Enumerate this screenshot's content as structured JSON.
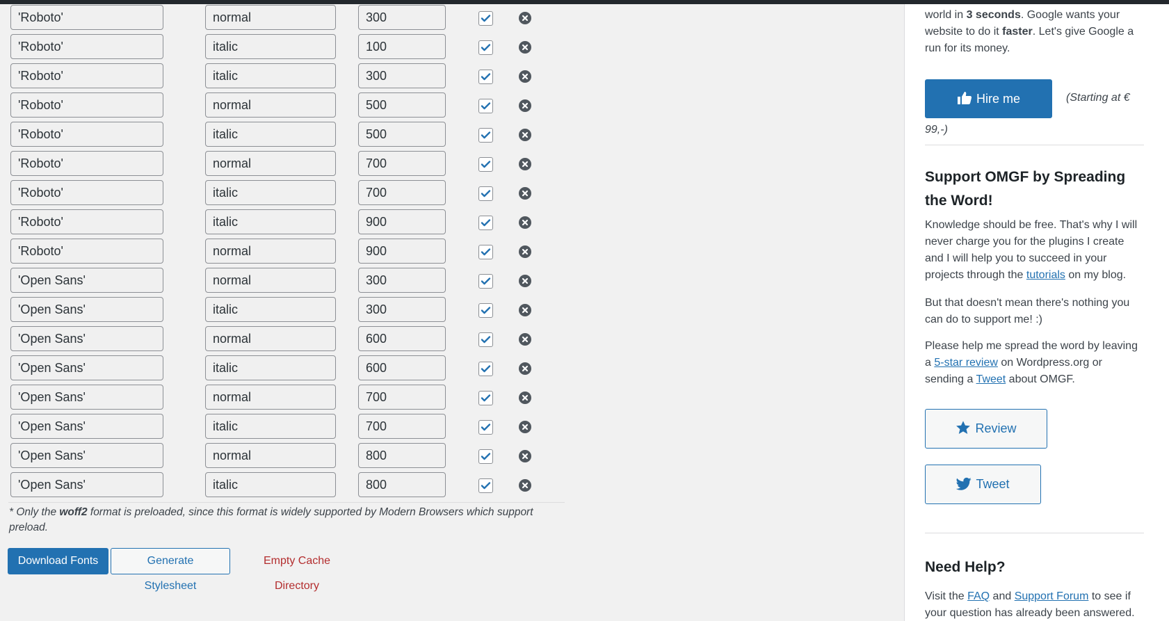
{
  "fonts": [
    {
      "family": "'Roboto'",
      "style": "normal",
      "weight": "300"
    },
    {
      "family": "'Roboto'",
      "style": "italic",
      "weight": "100"
    },
    {
      "family": "'Roboto'",
      "style": "italic",
      "weight": "300"
    },
    {
      "family": "'Roboto'",
      "style": "normal",
      "weight": "500"
    },
    {
      "family": "'Roboto'",
      "style": "italic",
      "weight": "500"
    },
    {
      "family": "'Roboto'",
      "style": "normal",
      "weight": "700"
    },
    {
      "family": "'Roboto'",
      "style": "italic",
      "weight": "700"
    },
    {
      "family": "'Roboto'",
      "style": "italic",
      "weight": "900"
    },
    {
      "family": "'Roboto'",
      "style": "normal",
      "weight": "900"
    },
    {
      "family": "'Open Sans'",
      "style": "normal",
      "weight": "300"
    },
    {
      "family": "'Open Sans'",
      "style": "italic",
      "weight": "300"
    },
    {
      "family": "'Open Sans'",
      "style": "normal",
      "weight": "600"
    },
    {
      "family": "'Open Sans'",
      "style": "italic",
      "weight": "600"
    },
    {
      "family": "'Open Sans'",
      "style": "normal",
      "weight": "700"
    },
    {
      "family": "'Open Sans'",
      "style": "italic",
      "weight": "700"
    },
    {
      "family": "'Open Sans'",
      "style": "normal",
      "weight": "800"
    },
    {
      "family": "'Open Sans'",
      "style": "italic",
      "weight": "800"
    }
  ],
  "note": {
    "prefix": "* Only the ",
    "bold": "woff2",
    "suffix": " format is preloaded, since this format is widely supported by Modern Browsers which support preload."
  },
  "actions": {
    "download": "Download Fonts",
    "generate": "Generate Stylesheet",
    "empty_cache": "Empty Cache Directory"
  },
  "sidebar": {
    "intro": {
      "p1": "world in ",
      "b1": "3 seconds",
      "p2": ". Google wants your website to do it ",
      "b2": "faster",
      "p3": ". Let's give Google a run for its money."
    },
    "hire_label": "Hire me",
    "starting_line1": "(Starting at €",
    "starting_line2": "99,-)",
    "support_title": "Support OMGF by Spreading the Word!",
    "support_p1_pre": "Knowledge should be free. That's why I will never charge you for the plugins I create and I will help you to succeed in your projects through the ",
    "support_p1_link": "tutorials",
    "support_p1_post": " on my blog.",
    "support_p2": "But that doesn't mean there's nothing you can do to support me! :)",
    "support_p3_pre": "Please help me spread the word by leaving a ",
    "support_p3_link1": "5-star review",
    "support_p3_mid": " on Wordpress.org or sending a ",
    "support_p3_link2": "Tweet",
    "support_p3_post": " about OMGF.",
    "review_label": "Review",
    "tweet_label": "Tweet",
    "help_title": "Need Help?",
    "help_pre": "Visit the ",
    "help_link1": "FAQ",
    "help_mid": " and ",
    "help_link2": "Support Forum",
    "help_post": " to see if your question has already been answered."
  },
  "colors": {
    "primary": "#2271b1",
    "danger": "#b32d2e",
    "background": "#f1f1f1"
  },
  "icons": {
    "checkbox": "checkmark-icon",
    "remove": "remove-circle-icon",
    "hire": "thumbs-up-icon",
    "review": "star-icon",
    "tweet": "twitter-icon"
  }
}
